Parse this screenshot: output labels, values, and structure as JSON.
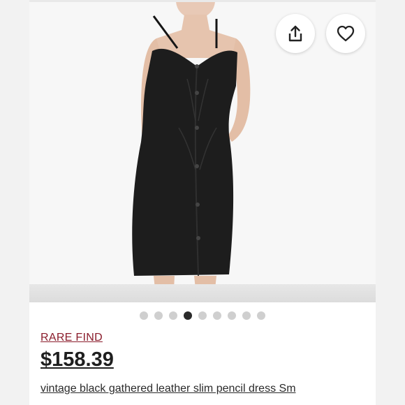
{
  "listing": {
    "badge": "RARE FIND",
    "price": "$158.39",
    "title": "vintage black gathered leather slim pencil dress Sm"
  },
  "gallery": {
    "image_count": 9,
    "active_index": 4,
    "image_subject": "black leather dress"
  },
  "actions": {
    "share_icon": "share-icon",
    "like_icon": "heart-icon"
  },
  "colors": {
    "badge": "#8a1c2b",
    "price": "#1f1f1f",
    "dot_active": "#2a2a2a",
    "dot_inactive": "#cfcfcf"
  }
}
